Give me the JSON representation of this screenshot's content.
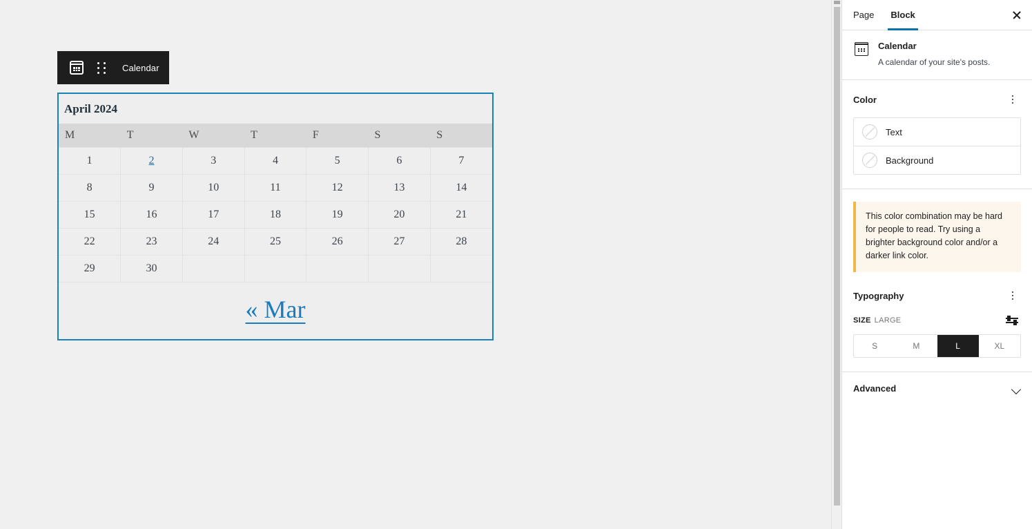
{
  "block_toolbar": {
    "block_icon": "calendar-icon",
    "drag_handle_icon": "drag-handle-icon",
    "label": "Calendar"
  },
  "calendar": {
    "caption": "April 2024",
    "day_headers": [
      "M",
      "T",
      "W",
      "T",
      "F",
      "S",
      "S"
    ],
    "weeks": [
      [
        {
          "day": "1",
          "link": false
        },
        {
          "day": "2",
          "link": true
        },
        {
          "day": "3",
          "link": false
        },
        {
          "day": "4",
          "link": false
        },
        {
          "day": "5",
          "link": false
        },
        {
          "day": "6",
          "link": false
        },
        {
          "day": "7",
          "link": false
        }
      ],
      [
        {
          "day": "8",
          "link": false
        },
        {
          "day": "9",
          "link": false
        },
        {
          "day": "10",
          "link": false
        },
        {
          "day": "11",
          "link": false
        },
        {
          "day": "12",
          "link": false
        },
        {
          "day": "13",
          "link": false
        },
        {
          "day": "14",
          "link": false
        }
      ],
      [
        {
          "day": "15",
          "link": false
        },
        {
          "day": "16",
          "link": false
        },
        {
          "day": "17",
          "link": false
        },
        {
          "day": "18",
          "link": false
        },
        {
          "day": "19",
          "link": false
        },
        {
          "day": "20",
          "link": false
        },
        {
          "day": "21",
          "link": false
        }
      ],
      [
        {
          "day": "22",
          "link": false
        },
        {
          "day": "23",
          "link": false
        },
        {
          "day": "24",
          "link": false
        },
        {
          "day": "25",
          "link": false
        },
        {
          "day": "26",
          "link": false
        },
        {
          "day": "27",
          "link": false
        },
        {
          "day": "28",
          "link": false
        }
      ],
      [
        {
          "day": "29",
          "link": false
        },
        {
          "day": "30",
          "link": false
        },
        {
          "day": "",
          "link": false
        },
        {
          "day": "",
          "link": false
        },
        {
          "day": "",
          "link": false
        },
        {
          "day": "",
          "link": false
        },
        {
          "day": "",
          "link": false
        }
      ]
    ],
    "prev_label": "« Mar",
    "link_color": "#1a7bbd",
    "selected_border_color": "#1a80b8"
  },
  "sidebar": {
    "tabs": [
      {
        "label": "Page",
        "active": false
      },
      {
        "label": "Block",
        "active": true
      }
    ],
    "close_icon": "close-icon",
    "active_tab_color": "#0c71a8",
    "block_card": {
      "icon": "calendar-icon",
      "title": "Calendar",
      "description": "A calendar of your site's posts."
    },
    "color_panel": {
      "title": "Color",
      "options_icon": "kebab-menu-icon",
      "items": [
        {
          "label": "Text",
          "swatch": "none"
        },
        {
          "label": "Background",
          "swatch": "none"
        }
      ]
    },
    "notice": {
      "text": "This color combination may be hard for people to read. Try using a brighter background color and/or a darker link color.",
      "accent_color": "#f0b849",
      "background_color": "#fdf6ed"
    },
    "typography_panel": {
      "title": "Typography",
      "options_icon": "kebab-menu-icon",
      "size_label": "SIZE",
      "size_value": "LARGE",
      "settings_icon": "sliders-icon",
      "sizes": [
        {
          "label": "S",
          "selected": false
        },
        {
          "label": "M",
          "selected": false
        },
        {
          "label": "L",
          "selected": true
        },
        {
          "label": "XL",
          "selected": false
        }
      ]
    },
    "advanced_panel": {
      "title": "Advanced",
      "chevron_icon": "chevron-down-icon"
    }
  }
}
